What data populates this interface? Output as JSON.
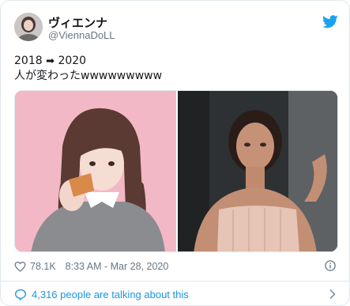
{
  "author": {
    "display_name": "ヴィエンナ",
    "handle": "@ViennaDoLL"
  },
  "tweet": {
    "line1_prefix": "2018 ",
    "arrow": "➡",
    "line1_suffix": " 2020",
    "line2": "人が変わったwwwwwwwww"
  },
  "icons": {
    "twitter": "twitter-bird-icon",
    "heart": "heart-outline-icon",
    "info": "info-icon",
    "reply": "speech-bubble-icon",
    "chevron": "chevron-right-icon"
  },
  "colors": {
    "brand_blue": "#1da1f2",
    "link_blue": "#1b95e0",
    "meta_gray": "#657786",
    "left_photo_bg": "#f2b6c3"
  },
  "stats": {
    "likes": "78.1K",
    "timestamp": "8:33 AM - Mar 28, 2020"
  },
  "footer": {
    "conversation_label": "4,316 people are talking about this"
  }
}
